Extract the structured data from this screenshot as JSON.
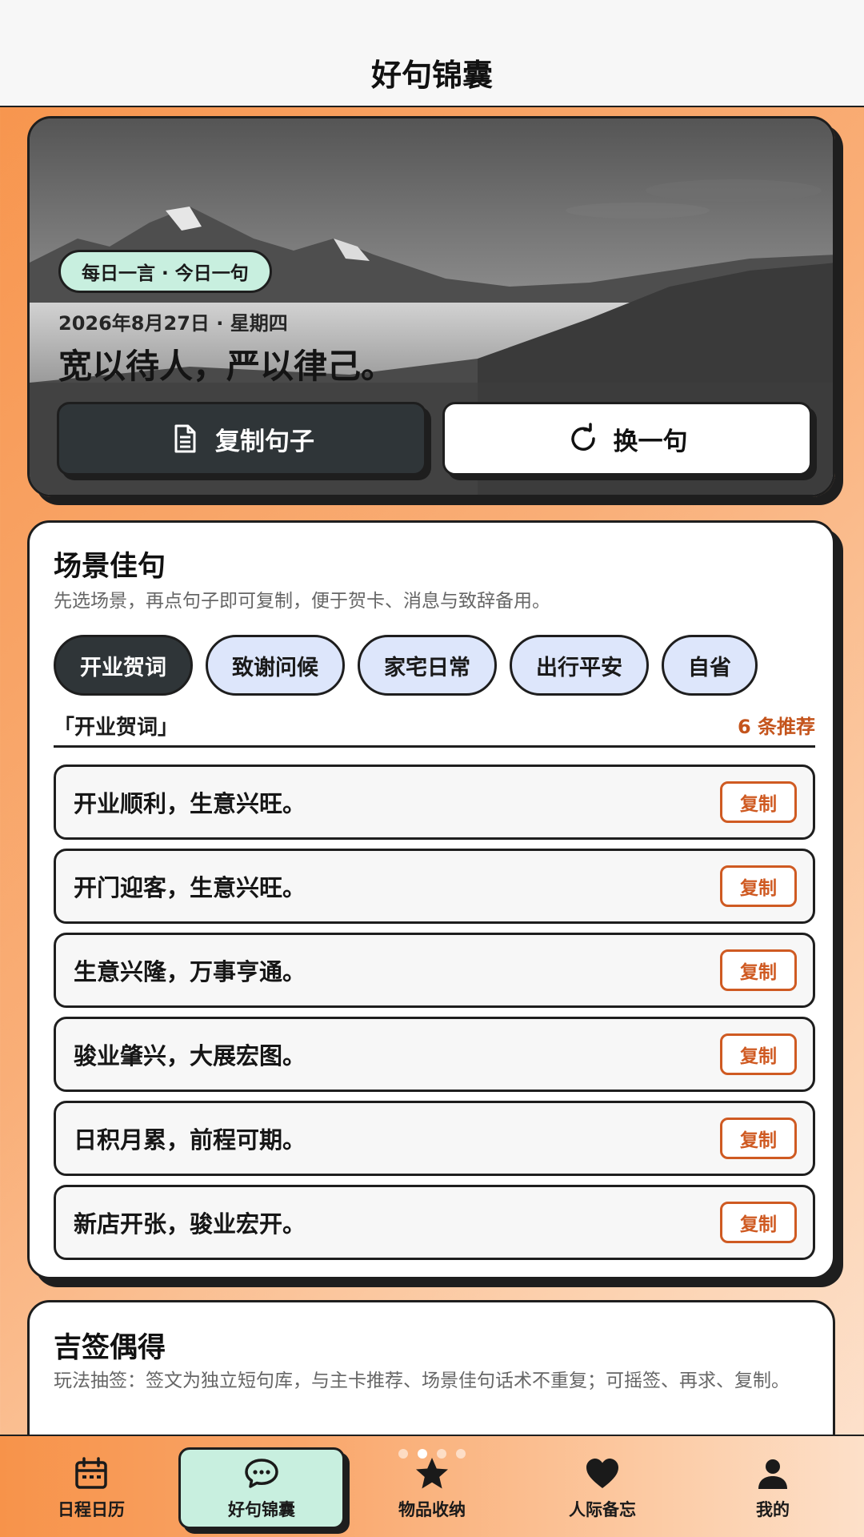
{
  "header": {
    "title": "好句锦囊"
  },
  "hero": {
    "badge": "每日一言 · 今日一句",
    "date": "2026年8月27日 · 星期四",
    "quote": "宽以待人，严以律己。",
    "copy_label": "复制句子",
    "next_label": "换一句"
  },
  "scene": {
    "title": "场景佳句",
    "subtitle": "先选场景，再点句子即可复制，便于贺卡、消息与致辞备用。",
    "chips": [
      "开业贺词",
      "致谢问候",
      "家宅日常",
      "出行平安",
      "自省"
    ],
    "active_chip": 0,
    "list_title": "「开业贺词」",
    "list_count": "6 条推荐",
    "copy_label": "复制",
    "phrases": [
      "开业顺利，生意兴旺。",
      "开门迎客，生意兴旺。",
      "生意兴隆，万事亨通。",
      "骏业肇兴，大展宏图。",
      "日积月累，前程可期。",
      "新店开张，骏业宏开。"
    ]
  },
  "lottery": {
    "title": "吉签偶得",
    "subtitle": "玩法抽签：签文为独立短句库，与主卡推荐、场景佳句话术不重复；可摇签、再求、复制。"
  },
  "nav": {
    "items": [
      {
        "label": "日程日历",
        "icon": "calendar-icon"
      },
      {
        "label": "好句锦囊",
        "icon": "chat-bubble-icon"
      },
      {
        "label": "物品收纳",
        "icon": "star-icon"
      },
      {
        "label": "人际备忘",
        "icon": "heart-icon"
      },
      {
        "label": "我的",
        "icon": "user-icon"
      }
    ],
    "active_index": 1,
    "page_dots": 4,
    "active_dot": 1
  },
  "colors": {
    "accent_orange": "#cf5a22",
    "mint": "#c8efdf",
    "chip_blue": "#dde6fb",
    "dark": "#2f3538"
  }
}
